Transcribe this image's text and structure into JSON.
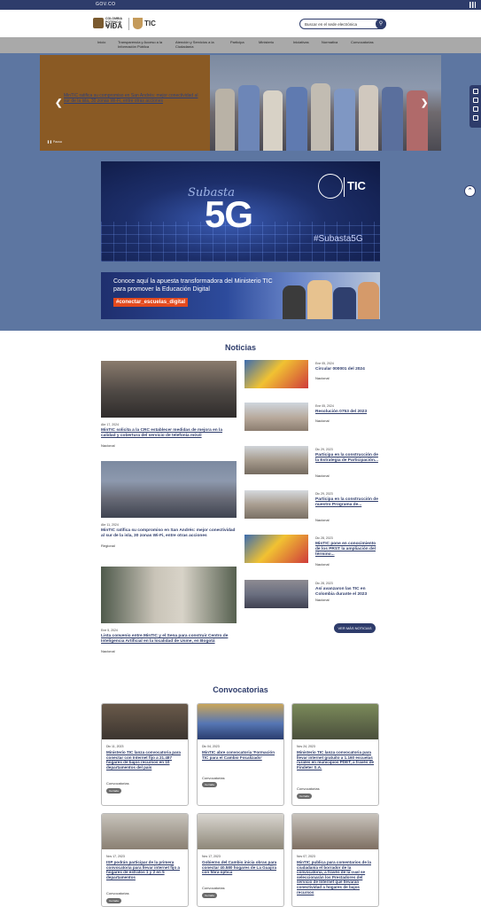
{
  "topbar": {
    "gov": "GOV.CO"
  },
  "header": {
    "logo1_small": "COLOMBIA POTENCIA DE LA",
    "logo1_big": "VIDA",
    "logo2": "TIC",
    "search_placeholder": "Buscar en el sede electrónica",
    "search_icon": "search-icon"
  },
  "nav": {
    "items": [
      "Inicio",
      "Transparencia y Acceso a la Información Pública",
      "Atención y Servicios a la Ciudadanía",
      "Participa",
      "Ministerio",
      "Iniciativas",
      "Normativa",
      "Convocatorias"
    ]
  },
  "carousel": {
    "text": "MinTIC ratifica su compromiso en San Andrés: mejor conectividad al sur de la isla, 30 zonas Wi-Fi, entre otras acciones",
    "pause": "Pausa",
    "active_slide": 2,
    "slide_count": 3
  },
  "banner5g": {
    "subasta": "Subasta",
    "big": "5G",
    "tic": "TIC",
    "hash": "#Subasta5G"
  },
  "banneredu": {
    "text": "Conoce aquí la apuesta transformadora del Ministerio TIC para promover la Educación Digital",
    "tag": "#conectar_escuelas_digital"
  },
  "noticias": {
    "title": "Noticias",
    "big": [
      {
        "date": "Abr 17, 2024",
        "title": "MinTIC solicita a la CRC establecer medidas de mejora en la calidad y cobertura del servicio de telefonía móvil",
        "cat": "Nacional"
      },
      {
        "date": "Abr 11, 2024",
        "title": "MinTIC ratifica su compromiso en San Andrés: mejor conectividad al sur de la isla, 30 zonas Wi-Fi, entre otras acciones",
        "cat": "Regional"
      },
      {
        "date": "Ene 5, 2024",
        "title": "Lista convenio entre MinTIC y el Sena para construir Centro de Inteligencia Artificial en la localidad de Usme, en Bogotá",
        "cat": "Nacional"
      }
    ],
    "small": [
      {
        "date": "Ene 05, 2024",
        "title": "Circular 000001 del 2024",
        "cat": "Nacional"
      },
      {
        "date": "Ene 05, 2024",
        "title": "Resolución 0753 del 2023",
        "cat": "Nacional"
      },
      {
        "date": "Dic 29, 2023",
        "title": "Participa en la construcción de la Estrategia de Participación...",
        "cat": "Nacional"
      },
      {
        "date": "Dic 29, 2023",
        "title": "Participa en la construcción de nuestro Programa de...",
        "cat": "Nacional"
      },
      {
        "date": "Dic 28, 2023",
        "title": "MinTIC pone en conocimiento de los PRST la ampliación del término...",
        "cat": "Nacional"
      },
      {
        "date": "Dic 28, 2023",
        "title": "Así avanzaron las TIC en Colombia durante el 2023",
        "cat": "Nacional"
      }
    ],
    "see_all": "VER MÁS NOTICIAS"
  },
  "convocatorias": {
    "title": "Convocatorias",
    "items": [
      {
        "date": "Dic 11, 2023",
        "title": "Ministerio TIC lanza convocatoria para conectar con Internet fijo a 21.487 hogares de bajos recursos en 10 departamentos del país",
        "cat": "Convocatorias",
        "chip": "Cerrada"
      },
      {
        "date": "Dic 04, 2023",
        "title": "MinTIC abre convocatoria 'Formación TIC para el Cambio Focalizado'",
        "cat": "Convocatorias",
        "chip": "Cerrada"
      },
      {
        "date": "Nov 24, 2023",
        "title": "Ministerio TIC lanza convocatoria para llevar internet gratuito a 1.160 escuelas rurales en municipios PDET, a través de Findeter S.A.",
        "cat": "Convocatorias",
        "chip": "Cerrada"
      },
      {
        "date": "Nov 17, 2023",
        "title": "ISP podrán participar de la primera convocatoria para llevar internet fijo a hogares de estratos 1 y 2 en 5 departamentos",
        "cat": "Convocatorias",
        "chip": "Cerrada"
      },
      {
        "date": "Nov 17, 2023",
        "title": "Gobierno del Cambio inicia obras para conectar 40.580 hogares de La Guajira con fibra óptica",
        "cat": "Convocatorias",
        "chip": "Cerrada"
      },
      {
        "date": "Nov 07, 2023",
        "title": "MinTIC publica para comentarios de la ciudadanía el borrador de la convocatoria, a través de la cual se seleccionarán los Prestadores del servicio de Internet que llevarán conectividad a hogares de bajos recursos",
        "cat": "Convocatorias",
        "chip": "Cerrada"
      }
    ]
  },
  "colors": {
    "primary": "#2e3c6b",
    "overlay": "#5d76a1",
    "accent": "#e34a1e"
  }
}
